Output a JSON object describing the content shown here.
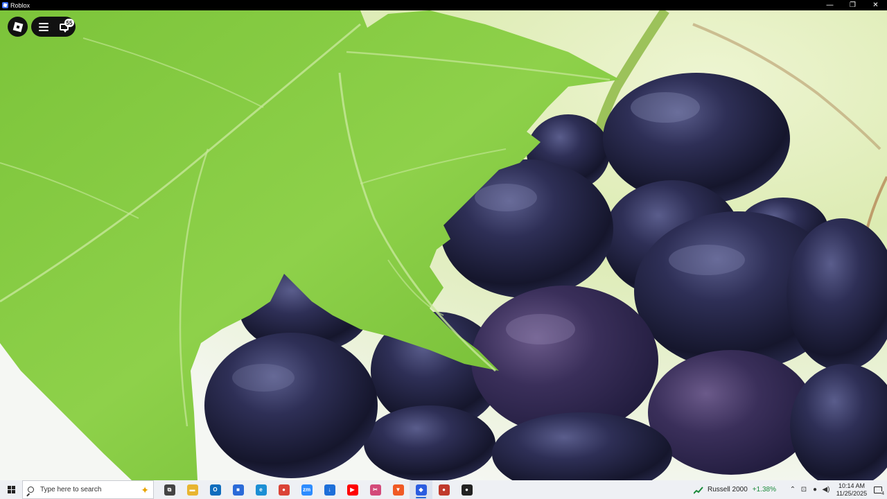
{
  "window": {
    "title": "Roblox",
    "controls": {
      "minimize": "—",
      "restore": "❐",
      "close": "✕"
    }
  },
  "roblox_overlay": {
    "chat_badge": "55"
  },
  "taskbar": {
    "search_placeholder": "Type here to search",
    "pinned_apps": [
      {
        "name": "task-view",
        "label": "⧉",
        "color": "#444444"
      },
      {
        "name": "file-explorer",
        "label": "▬",
        "color": "#e8b530"
      },
      {
        "name": "outlook",
        "label": "O",
        "color": "#0f6cbd"
      },
      {
        "name": "microsoft-store",
        "label": "■",
        "color": "#2b6ad8"
      },
      {
        "name": "edge",
        "label": "e",
        "color": "#1d8fd4"
      },
      {
        "name": "chrome",
        "label": "●",
        "color": "#db4437"
      },
      {
        "name": "zoom",
        "label": "zm",
        "color": "#2d8cff"
      },
      {
        "name": "downloads",
        "label": "↓",
        "color": "#1e6fd9"
      },
      {
        "name": "youtube",
        "label": "▶",
        "color": "#ff0000"
      },
      {
        "name": "snipping-tool",
        "label": "✂",
        "color": "#d34a7a"
      },
      {
        "name": "brave",
        "label": "▼",
        "color": "#f05a24"
      },
      {
        "name": "roblox",
        "label": "◆",
        "color": "#2b5de0"
      },
      {
        "name": "chrome-profile",
        "label": "●",
        "color": "#c03a2b"
      },
      {
        "name": "roblox-player",
        "label": "●",
        "color": "#222222"
      }
    ],
    "active_app_index": 11,
    "stock": {
      "name": "Russell 2000",
      "change": "+1.38%",
      "color": "#1a8a3a"
    },
    "clock": {
      "time": "10:14 AM",
      "date": "11/25/2025"
    },
    "notification_count": "4"
  }
}
